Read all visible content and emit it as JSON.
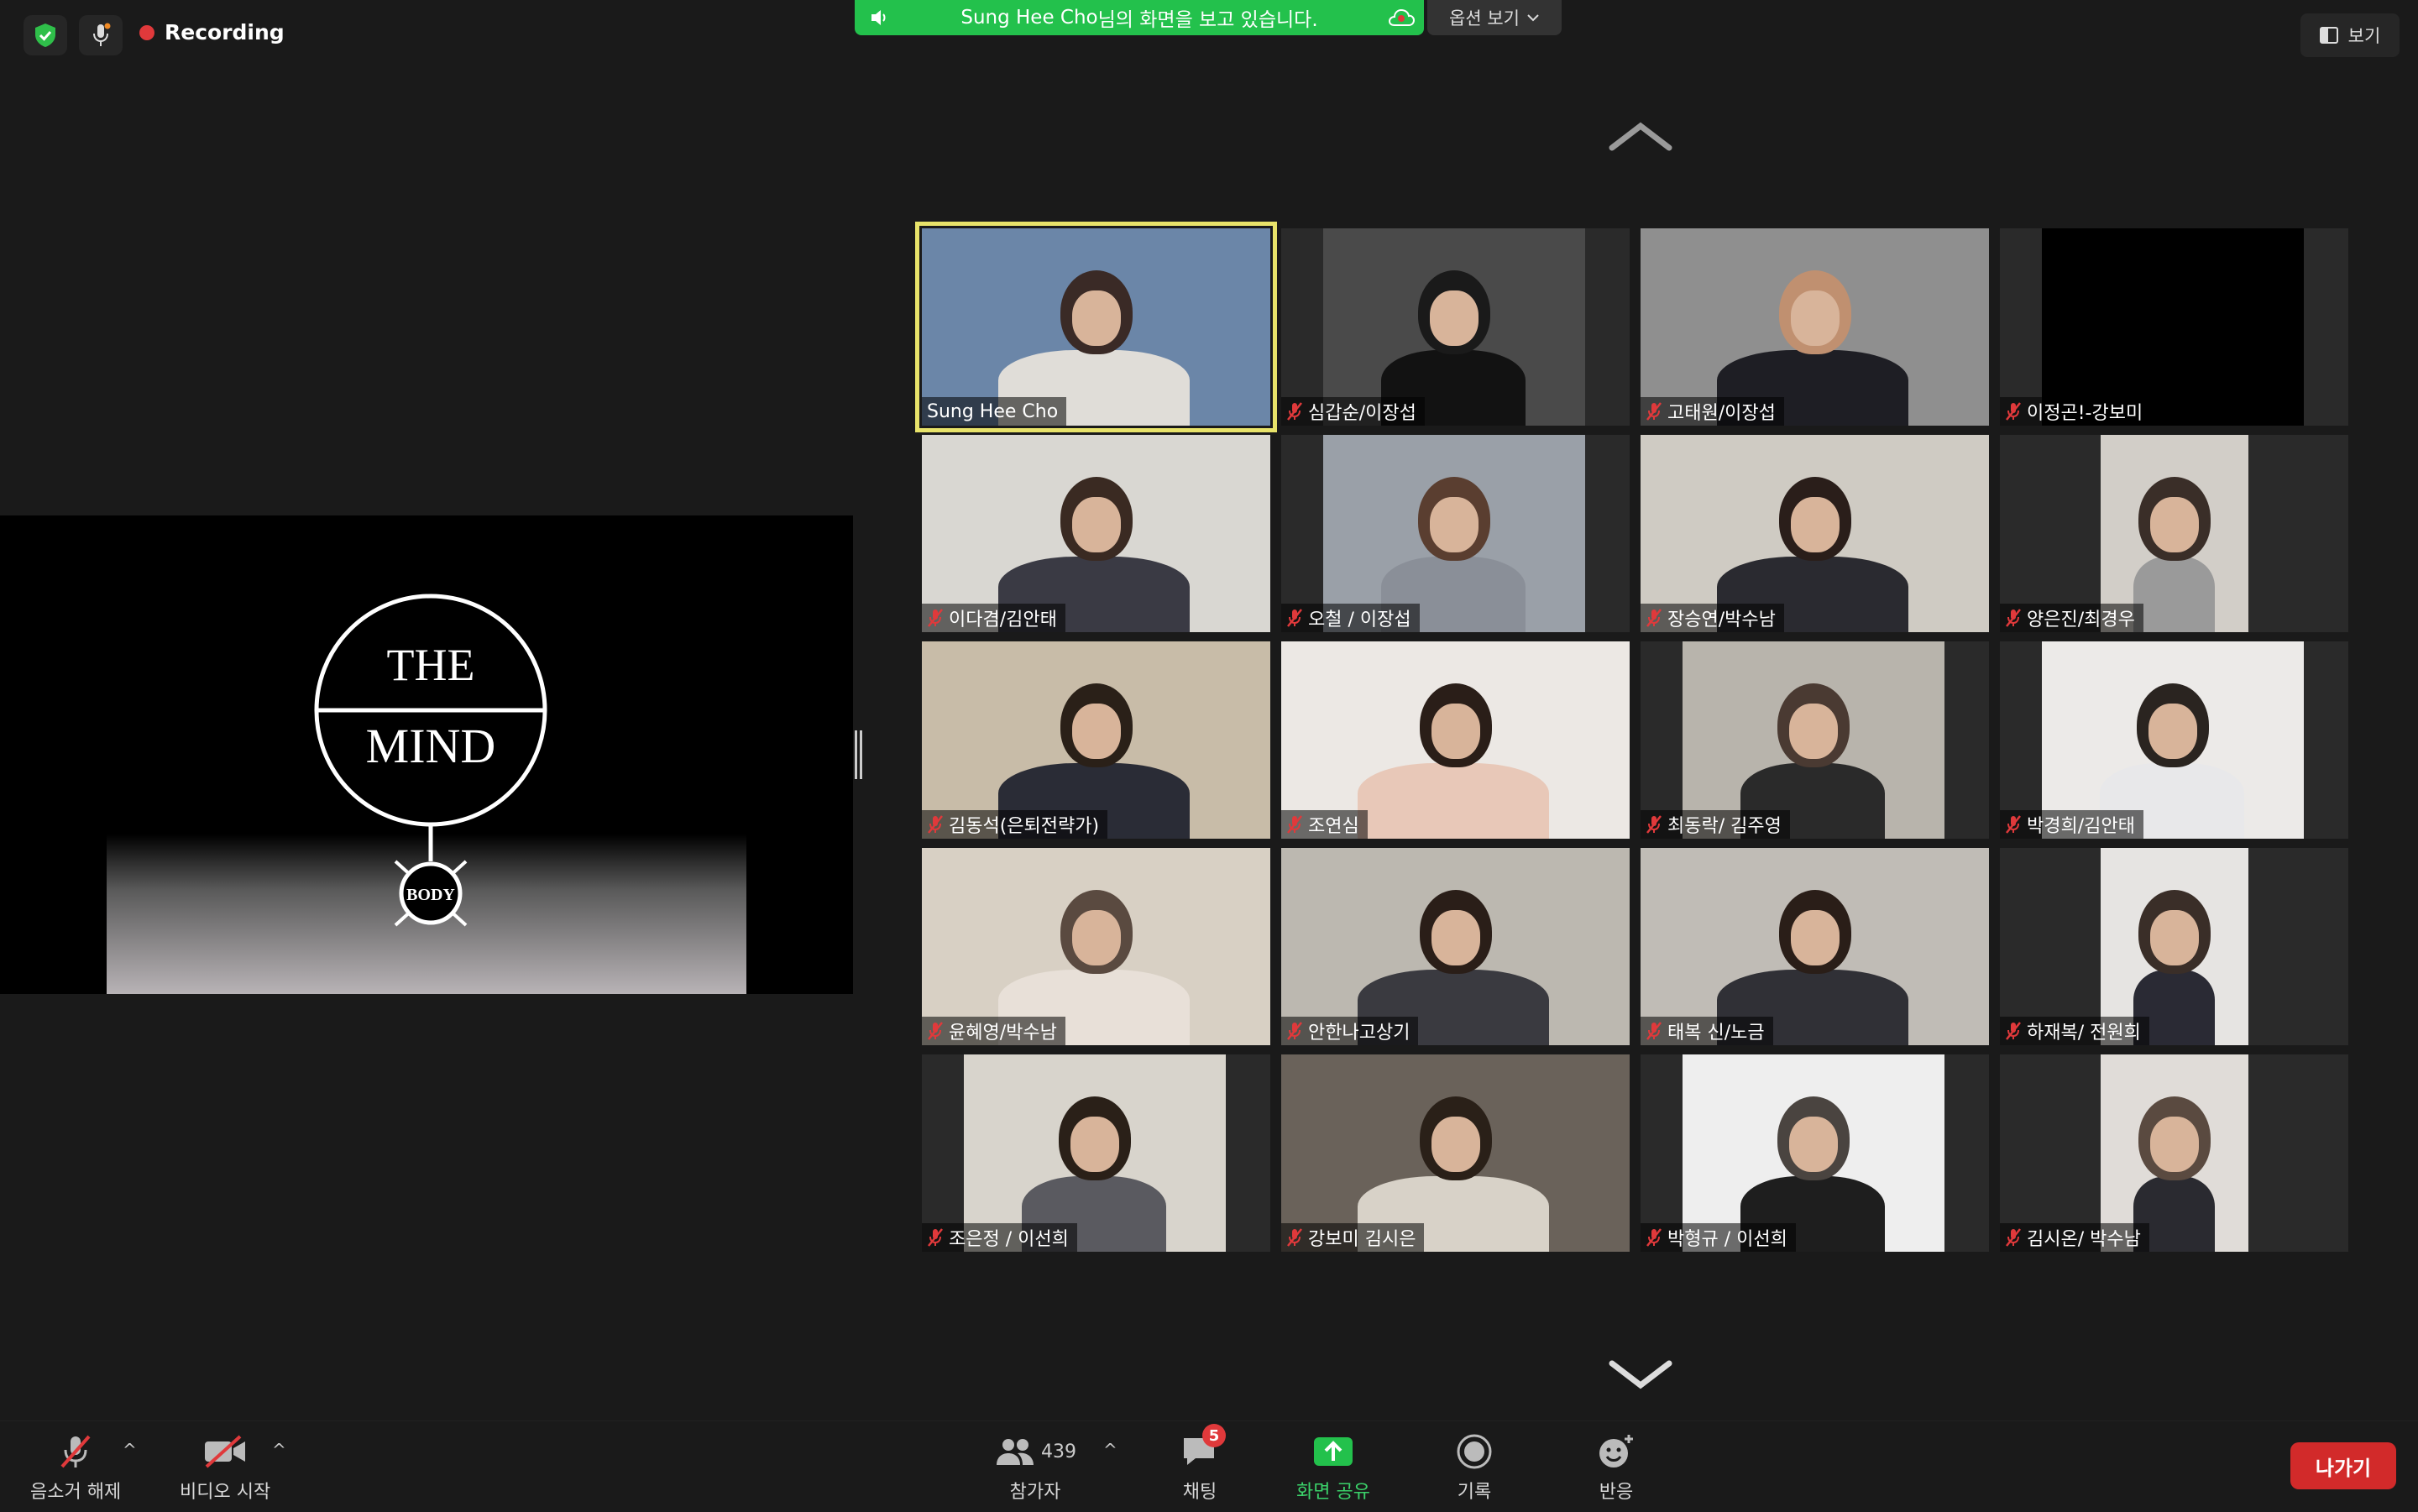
{
  "topbar": {
    "recording_label": "Recording",
    "banner_prefix": "Sung Hee Cho",
    "banner_suffix": "님의 화면을 보고 있습니다.",
    "options_label": "옵션 보기",
    "view_label": "보기"
  },
  "share": {
    "line1": "THE",
    "line2": "MIND",
    "line3": "BODY"
  },
  "participants": [
    {
      "name": "Sung Hee Cho",
      "muted": false,
      "active": true
    },
    {
      "name": "심갑순/이장섭",
      "muted": true
    },
    {
      "name": "고태원/이장섭",
      "muted": true
    },
    {
      "name": "이정곤!-강보미",
      "muted": true
    },
    {
      "name": "이다겸/김안태",
      "muted": true
    },
    {
      "name": "오철 / 이장섭",
      "muted": true
    },
    {
      "name": "장승연/박수남",
      "muted": true
    },
    {
      "name": "양은진/최경우",
      "muted": true
    },
    {
      "name": "김동석(은퇴전략가)",
      "muted": true
    },
    {
      "name": "조연심",
      "muted": true
    },
    {
      "name": "최동락/ 김주영",
      "muted": true
    },
    {
      "name": "박경희/김안태",
      "muted": true
    },
    {
      "name": "윤혜영/박수남",
      "muted": true
    },
    {
      "name": "안한나고상기",
      "muted": true
    },
    {
      "name": "태복 신/노금",
      "muted": true
    },
    {
      "name": "하재복/ 전원희",
      "muted": true
    },
    {
      "name": "조은정 / 이선희",
      "muted": true
    },
    {
      "name": "강보미 김시은",
      "muted": true
    },
    {
      "name": "박형규 / 이선희",
      "muted": true
    },
    {
      "name": "김시온/ 박수남",
      "muted": true
    }
  ],
  "toolbar": {
    "unmute_label": "음소거 해제",
    "video_label": "비디오 시작",
    "participants_label": "참가자",
    "participants_count": "439",
    "chat_label": "채팅",
    "chat_badge": "5",
    "share_label": "화면 공유",
    "record_label": "기록",
    "reactions_label": "반응",
    "leave_label": "나가기"
  },
  "colors": {
    "active_speaker": "#e8e36a",
    "share_green": "#23c14c",
    "leave_red": "#d22a2a",
    "mute_red": "#e0393b"
  }
}
